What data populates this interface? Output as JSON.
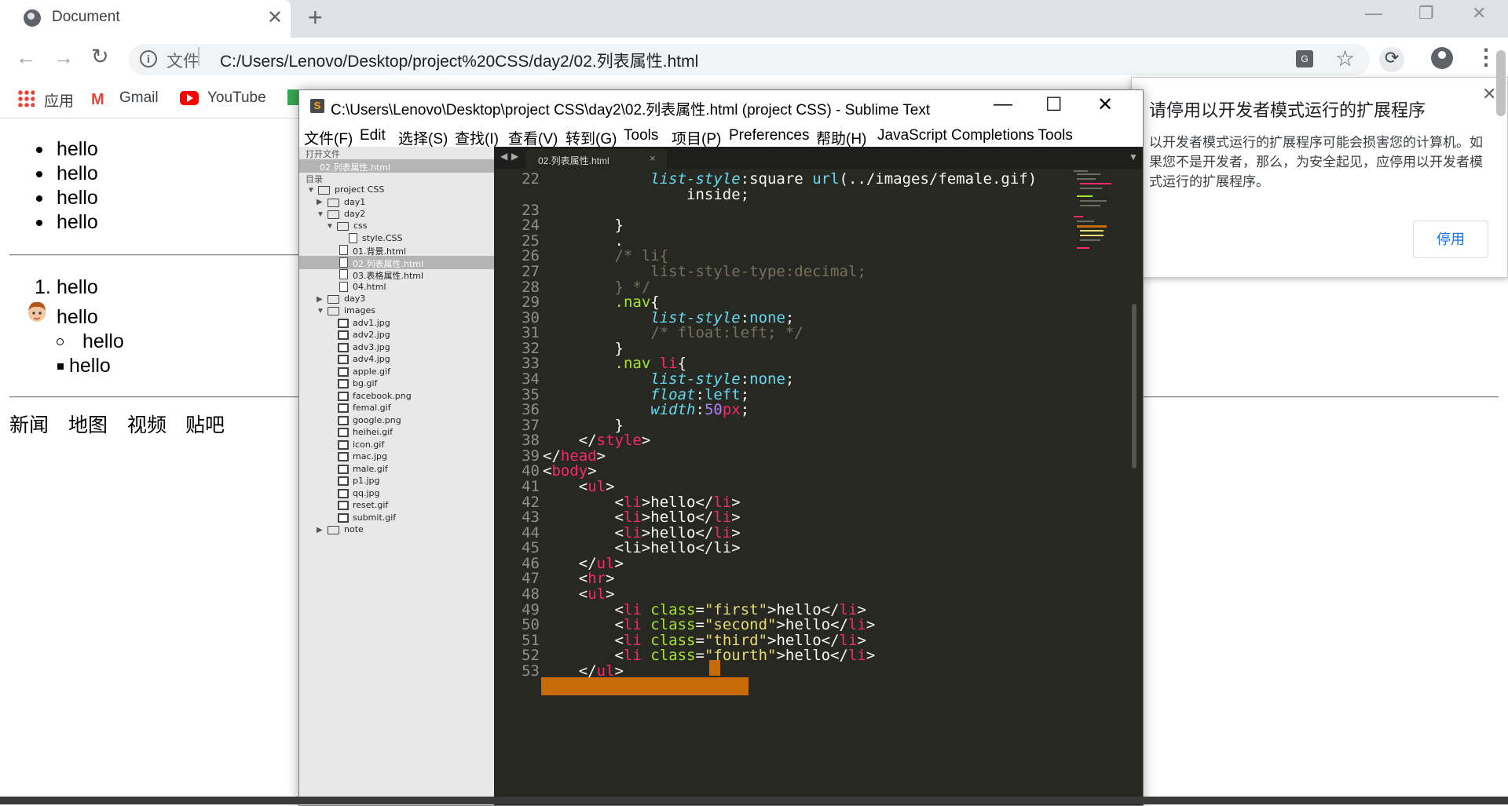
{
  "browser": {
    "tab_title": "Document",
    "tab_close": "✕",
    "new_tab": "+",
    "window_controls": [
      "—",
      "❐",
      "✕"
    ],
    "back": "←",
    "forward": "→",
    "reload": "↻",
    "url_scheme_label": "文件",
    "url": "C:/Users/Lenovo/Desktop/project%20CSS/day2/02.列表属性.html",
    "translate_glyph": "G",
    "star": "☆",
    "menu": "⋮"
  },
  "bookmarks": {
    "apps": "应用",
    "gmail": "Gmail",
    "gmail_glyph": "M",
    "youtube": "YouTube"
  },
  "page": {
    "ul1": [
      "hello",
      "hello",
      "hello",
      "hello"
    ],
    "ol_marker": "1.",
    "ul2": [
      "hello",
      "hello",
      "hello",
      "hello"
    ],
    "nav": [
      "新闻",
      "地图",
      "视频",
      "贴吧"
    ]
  },
  "sublime": {
    "icon_glyph": "S",
    "title": "C:\\Users\\Lenovo\\Desktop\\project CSS\\day2\\02.列表属性.html (project CSS) - Sublime Text",
    "menu": [
      "文件(F)",
      "Edit",
      "选择(S)",
      "查找(I)",
      "查看(V)",
      "转到(G)",
      "Tools",
      "项目(P)",
      "Preferences",
      "帮助(H)",
      "JavaScript Completions Tools"
    ],
    "sidebar": {
      "open_files_header": "打开文件",
      "open_file": "02.列表属性.html",
      "folders_header": "目录",
      "project": "project CSS",
      "day1": "day1",
      "day2": "day2",
      "css": "css",
      "style_css": "style.CSS",
      "day2_files": [
        "01.背景.html",
        "02.列表属性.html",
        "03.表格属性.html",
        "04.html"
      ],
      "day3": "day3",
      "images": "images",
      "image_files": [
        "adv1.jpg",
        "adv2.jpg",
        "adv3.jpg",
        "adv4.jpg",
        "apple.gif",
        "bg.gif",
        "facebook.png",
        "femal.gif",
        "google.png",
        "heihei.gif",
        "icon.gif",
        "mac.jpg",
        "male.gif",
        "p1.jpg",
        "qq.jpg",
        "reset.gif",
        "submit.gif"
      ],
      "note": "note"
    },
    "tab_label": "02.列表属性.html",
    "tab_close": "×",
    "line_numbers": [
      "22",
      "23",
      "24",
      "25",
      "26",
      "27",
      "28",
      "29",
      "30",
      "31",
      "32",
      "33",
      "34",
      "35",
      "36",
      "37",
      "38",
      "39",
      "40",
      "41",
      "42",
      "43",
      "44",
      "45",
      "46",
      "47",
      "48",
      "49",
      "50",
      "51",
      "52",
      "53"
    ]
  },
  "popup": {
    "title": "请停用以开发者模式运行的扩展程序",
    "body": "以开发者模式运行的扩展程序可能会损害您的计算机。如果您不是开发者，那么，为安全起见，应停用以开发者模式运行的扩展程序。",
    "button": "停用",
    "close": "✕"
  }
}
